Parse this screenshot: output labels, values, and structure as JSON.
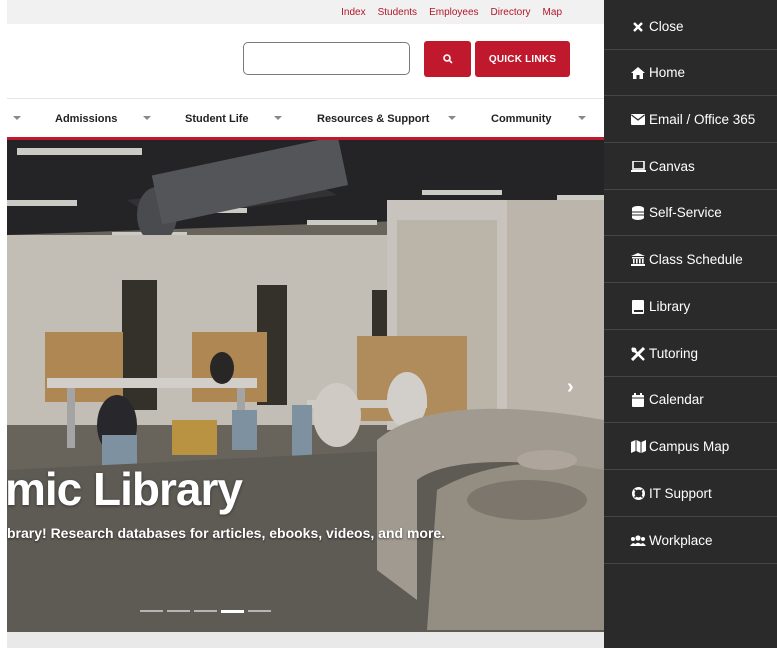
{
  "utility_links": [
    "Index",
    "Students",
    "Employees",
    "Directory",
    "Map"
  ],
  "search": {
    "placeholder": "",
    "button_icon": "search-icon",
    "quick_links_label": "QUICK LINKS"
  },
  "nav": {
    "items": [
      "Admissions",
      "Student Life",
      "Resources & Support",
      "Community"
    ]
  },
  "hero": {
    "title": "mic Library",
    "subtitle": "brary! Research databases for articles, ebooks, videos, and more.",
    "slide_count": 5,
    "active_slide": 4
  },
  "drawer": {
    "close_label": "Close",
    "items": [
      {
        "label": "Home",
        "icon": "home-icon"
      },
      {
        "label": "Email / Office 365",
        "icon": "envelope-icon"
      },
      {
        "label": "Canvas",
        "icon": "laptop-icon"
      },
      {
        "label": "Self-Service",
        "icon": "database-icon"
      },
      {
        "label": "Class Schedule",
        "icon": "university-icon"
      },
      {
        "label": "Library",
        "icon": "book-icon"
      },
      {
        "label": "Tutoring",
        "icon": "tools-icon"
      },
      {
        "label": "Calendar",
        "icon": "calendar-icon"
      },
      {
        "label": "Campus Map",
        "icon": "map-icon"
      },
      {
        "label": "IT Support",
        "icon": "life-ring-icon"
      },
      {
        "label": "Workplace",
        "icon": "users-icon"
      }
    ]
  },
  "colors": {
    "brand_red": "#c0182c",
    "drawer_bg": "#2a2a2a"
  }
}
